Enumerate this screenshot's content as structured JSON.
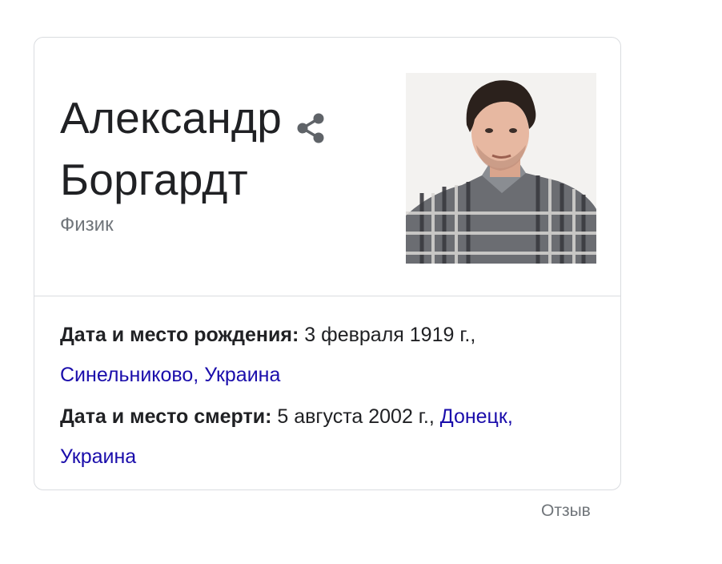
{
  "card": {
    "name_line1": "Александр",
    "name_line2": "Боргардт",
    "subtitle": "Физик",
    "share_icon": "share-icon",
    "photo_icon": "person-portrait"
  },
  "facts": [
    {
      "label": "Дата и место рождения:",
      "date": "3 февраля 1919 г.,",
      "place_link": "Синельниково, Украина"
    },
    {
      "label": "Дата и место смерти:",
      "date": "5 августа 2002 г.,",
      "place_link_line1": "Донецк,",
      "place_link_line2": "Украина"
    }
  ],
  "feedback_label": "Отзыв",
  "colors": {
    "link": "#1a0dab",
    "secondary_text": "#70757a",
    "border": "#dadce0",
    "text": "#202124"
  }
}
